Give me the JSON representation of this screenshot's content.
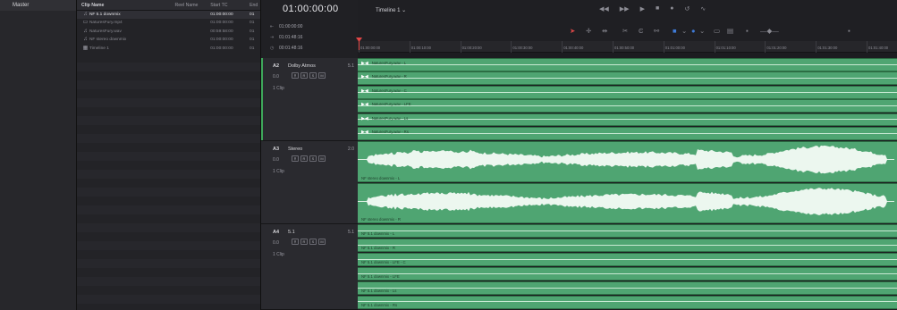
{
  "bins": {
    "items": [
      "Master"
    ]
  },
  "media_pool": {
    "columns": {
      "name": "Clip Name",
      "reel": "Reel Name",
      "start_tc": "Start TC",
      "end": "End"
    },
    "rows": [
      {
        "icon": "music-note-icon",
        "glyph": "♫",
        "name": "NF 5.1 downmix",
        "reel": "",
        "tc": "01:00:00:00",
        "end": "01",
        "selected": true
      },
      {
        "icon": "film-clip-icon",
        "glyph": "▭",
        "name": "NaturesFury.mp4",
        "reel": "",
        "tc": "01:00:00:00",
        "end": "01",
        "selected": false
      },
      {
        "icon": "music-note-icon",
        "glyph": "♫",
        "name": "NaturesFury.wav",
        "reel": "",
        "tc": "00:59:58:00",
        "end": "01",
        "selected": false
      },
      {
        "icon": "music-note-icon",
        "glyph": "♫",
        "name": "NF stereo downmix",
        "reel": "",
        "tc": "01:00:00:00",
        "end": "01",
        "selected": false
      },
      {
        "icon": "timeline-icon",
        "glyph": "▦",
        "name": "Timeline 1",
        "reel": "",
        "tc": "01:00:00:00",
        "end": "01",
        "selected": false
      }
    ]
  },
  "timecode": {
    "main": "01:00:00:00",
    "in": "01:00:00:00",
    "out": "01:01:48:16",
    "duration": "00:01:48:16"
  },
  "timeline": {
    "title": "Timeline 1",
    "title_chevron": "⌄",
    "ruler_ticks": [
      "01:00:00:00",
      "01:00:10:00",
      "01:00:20:00",
      "01:00:30:00",
      "01:00:40:00",
      "01:00:50:00",
      "01:01:00:00",
      "01:01:10:00",
      "01:01:20:00",
      "01:01:30:00",
      "01:01:40:00"
    ]
  },
  "tracks": [
    {
      "id": "A2",
      "name": "Dolby Atmos",
      "format": "5.1",
      "volume": "0.0",
      "clips": "1 Clip",
      "lanes": [
        "NaturesFury.wav - L",
        "NaturesFury.wav - R",
        "NaturesFury.wav - C",
        "NaturesFury.wav - LFE",
        "NaturesFury.wav - Ls",
        "NaturesFury.wav - Rs"
      ]
    },
    {
      "id": "A3",
      "name": "Stereo",
      "format": "2.0",
      "volume": "0.0",
      "clips": "1 Clip",
      "lanes": [
        "NF stereo downmix - L",
        "NF stereo downmix - R"
      ]
    },
    {
      "id": "A4",
      "name": "5.1",
      "format": "5.1",
      "volume": "0.0",
      "clips": "1 Clip",
      "lanes": [
        "NF 5.1 downmix - L",
        "NF 5.1 downmix - R",
        "NF 5.1 downmix - LFE - C",
        "NF 5.1 downmix - LFE",
        "NF 5.1 downmix - Ls",
        "NF 5.1 downmix - Rs"
      ]
    }
  ],
  "track_buttons": [
    "lock-icon",
    "R",
    "S",
    "M"
  ],
  "colors": {
    "clip_green": "#4fa572",
    "playhead": "#e24646",
    "track_accent": "#3ea85a",
    "selection_blue": "#3f7bd8"
  }
}
